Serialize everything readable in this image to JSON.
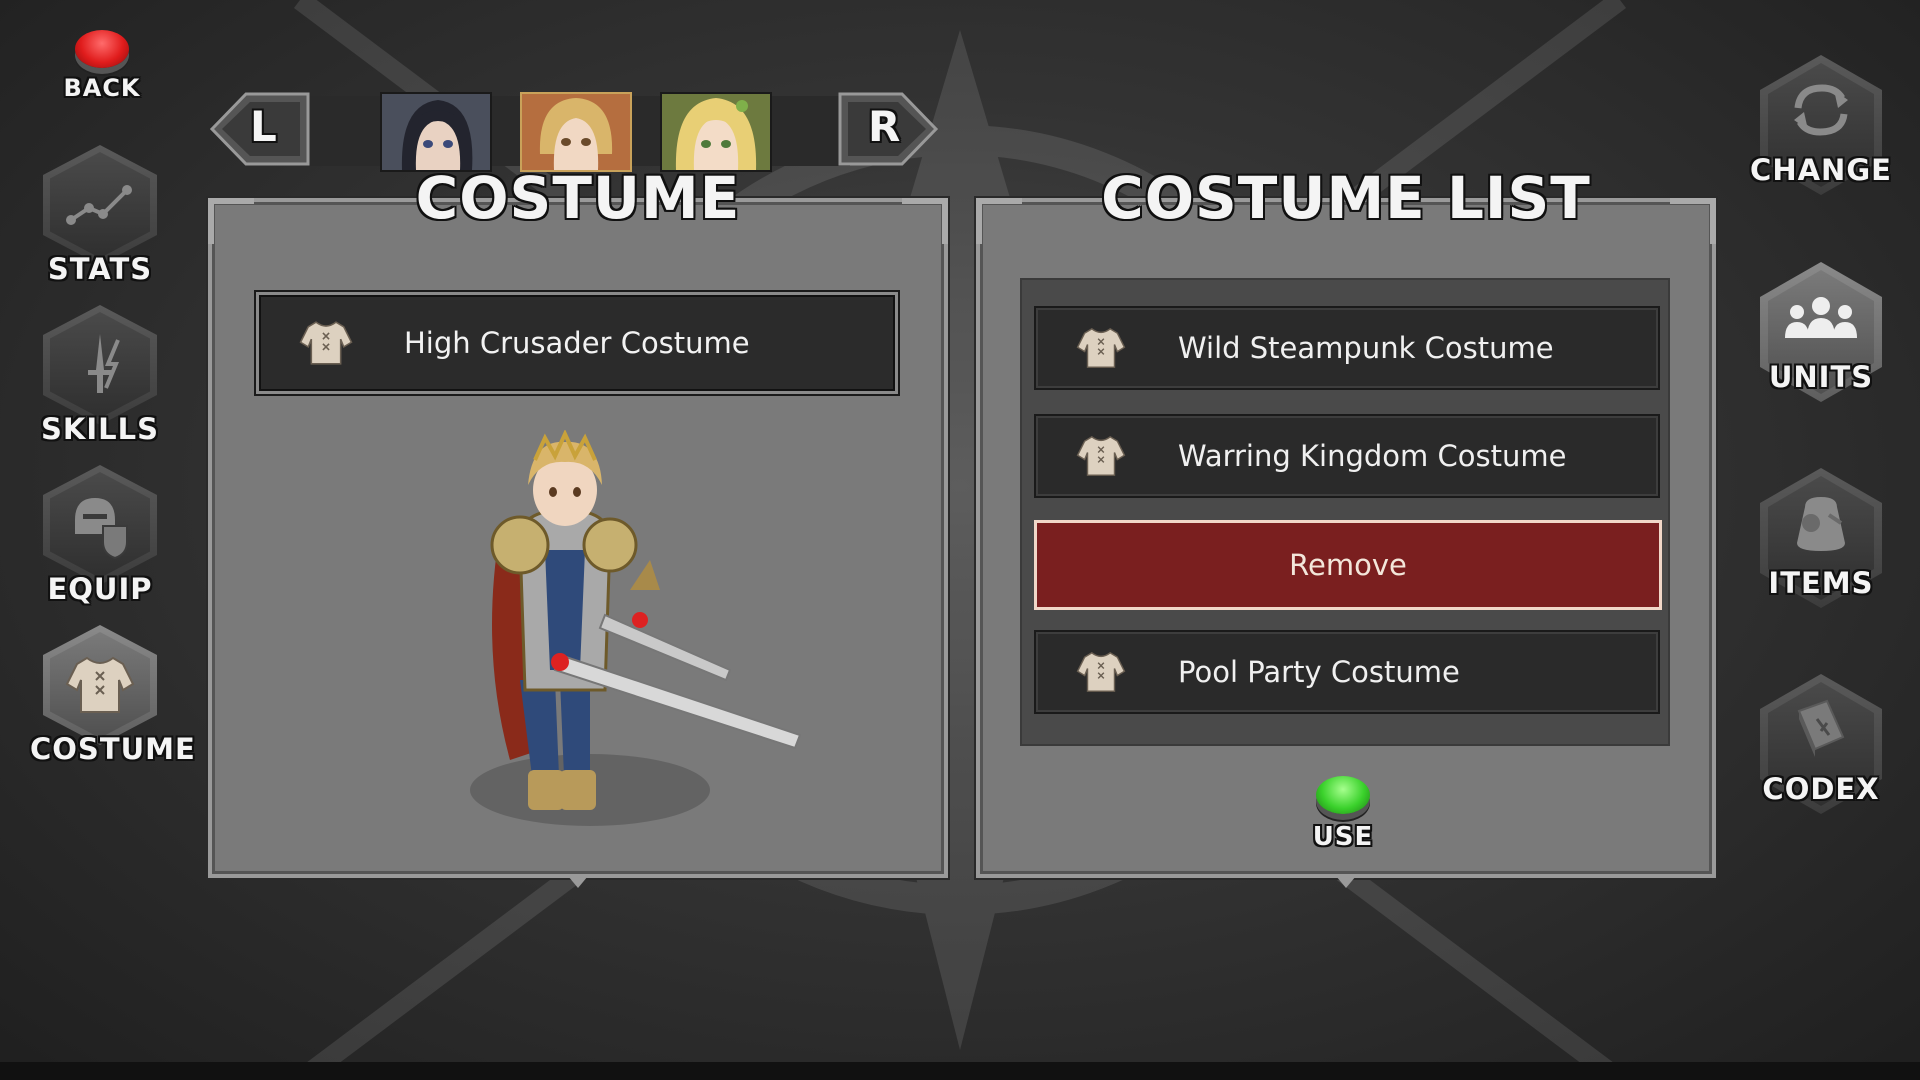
{
  "back": {
    "label": "BACK"
  },
  "sidebar_left": [
    {
      "id": "stats",
      "label": "STATS",
      "icon": "stats-icon",
      "active": false
    },
    {
      "id": "skills",
      "label": "SKILLS",
      "icon": "sword-lightning-icon",
      "active": false
    },
    {
      "id": "equip",
      "label": "EQUIP",
      "icon": "helmet-shield-icon",
      "active": false
    },
    {
      "id": "costume",
      "label": "COSTUME",
      "icon": "shirt-icon",
      "active": true
    }
  ],
  "sidebar_right": [
    {
      "id": "change",
      "label": "CHANGE",
      "icon": "refresh-icon"
    },
    {
      "id": "units",
      "label": "UNITS",
      "icon": "group-icon"
    },
    {
      "id": "items",
      "label": "ITEMS",
      "icon": "bag-icon"
    },
    {
      "id": "codex",
      "label": "CODEX",
      "icon": "book-icon"
    }
  ],
  "char_selector": {
    "left_label": "L",
    "right_label": "R",
    "portraits": [
      {
        "name": "dark-haired",
        "hair": "#2a2a36",
        "selected": false
      },
      {
        "name": "blonde-knight",
        "hair": "#d9b56a",
        "selected": true
      },
      {
        "name": "blonde-elf",
        "hair": "#e8cf75",
        "selected": false
      }
    ]
  },
  "costume_panel": {
    "title": "COSTUME",
    "equipped": "High Crusader Costume"
  },
  "costume_list_panel": {
    "title": "COSTUME LIST",
    "items": [
      {
        "label": "Wild Steampunk Costume",
        "type": "costume"
      },
      {
        "label": "Warring Kingdom Costume",
        "type": "costume"
      },
      {
        "label": "Remove",
        "type": "remove"
      },
      {
        "label": "Pool Party Costume",
        "type": "costume"
      }
    ],
    "use_label": "USE"
  },
  "colors": {
    "remove_bg": "#7a1f1f",
    "back_button": "#e01c1c",
    "use_button": "#3ad12b"
  }
}
